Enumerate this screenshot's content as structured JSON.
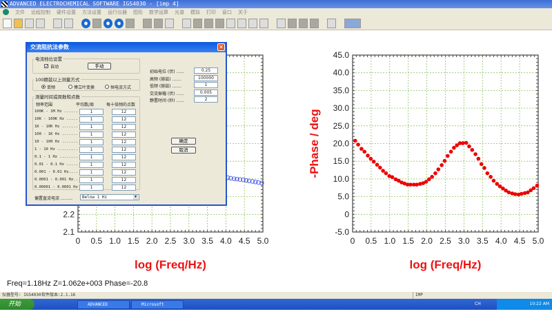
{
  "window": {
    "title": "ADVANCED ELECTROCHEMICAL SOFTWARE IGS4030 - [imp 4]"
  },
  "menu": [
    "文件",
    "远程控制",
    "硬件设置",
    "方法设置",
    "运行仪器",
    "图形",
    "数学运算",
    "光谱",
    "模拟",
    "打印",
    "窗口",
    "关于"
  ],
  "readout": "Freq=1.18Hz  Z=1.062e+003  Phase=-20.8",
  "status": {
    "model": "仪器型号: IGS4030",
    "version": "软件版本:2.1.16",
    "mode": "IMP"
  },
  "taskbar": {
    "start": "开始",
    "tasks": [
      "ADVANCED ELECTRO...",
      "Microsoft PowerP..."
    ],
    "lang": "CH",
    "clock": "10:22 AM"
  },
  "dialog": {
    "title": "交流阻抗法参数",
    "current_group": "电流档位设置",
    "auto_label": "自动",
    "auto_checked": true,
    "manual_button": "手动",
    "mode_group": "100赫兹以上测量方式",
    "modes": [
      "单频",
      "傅立叶变换",
      "恒电流方式"
    ],
    "mode_selected": 0,
    "table_group": "测量时间或周数和点数",
    "headers": [
      "频率范围",
      "平均数/周",
      "每十倍频的点数"
    ],
    "rows": [
      {
        "range": "100K - 1M Hz ......",
        "avg": "1",
        "pts": "12"
      },
      {
        "range": "10K - 100K Hz .....",
        "avg": "1",
        "pts": "12"
      },
      {
        "range": "1K - 10K Hz .......",
        "avg": "1",
        "pts": "12"
      },
      {
        "range": "100 - 1K Hz .......",
        "avg": "1",
        "pts": "12"
      },
      {
        "range": "10 - 100 Hz .......",
        "avg": "1",
        "pts": "12"
      },
      {
        "range": "1 - 10 Hz .........",
        "avg": "1",
        "pts": "12"
      },
      {
        "range": "0.1 - 1 Hz ........",
        "avg": "1",
        "pts": "12"
      },
      {
        "range": "0.01 - 0.1 Hz .....",
        "avg": "1",
        "pts": "12"
      },
      {
        "range": "0.001 - 0.01 Hz....",
        "avg": "1",
        "pts": "12"
      },
      {
        "range": "0.0001 - 0.001 Hz..",
        "avg": "1",
        "pts": "12"
      },
      {
        "range": "0.00001 - 0.0001 Hz",
        "avg": "1",
        "pts": "12"
      }
    ],
    "fields": [
      {
        "label": "初始电位 (伏) ......",
        "value": "0.25"
      },
      {
        "label": "高频 (赫兹) .......",
        "value": "100000"
      },
      {
        "label": "低频 (赫兹) .......",
        "value": "1"
      },
      {
        "label": "交流振幅 (伏) ......",
        "value": "0.005"
      },
      {
        "label": "静置时间 (秒) ......",
        "value": "2"
      }
    ],
    "ok": "确定",
    "cancel": "取消",
    "bias_label": "偏置直流电流 .........",
    "bias_value": "Below 1 Hz"
  },
  "chart_data": [
    {
      "type": "scatter",
      "title": "",
      "xlabel": "log (Freq/Hz)",
      "ylabel": "",
      "xlim": [
        0,
        5
      ],
      "ylim": [
        2.1,
        3.1
      ],
      "xticks": [
        "0",
        "0.5",
        "1.0",
        "1.5",
        "2.0",
        "2.5",
        "3.0",
        "3.5",
        "4.0",
        "4.5",
        "5.0"
      ],
      "yticks_visible": [
        "2.2",
        "2.1"
      ],
      "color": "#3344ee",
      "marker": "open-circle",
      "x": [
        4.05,
        4.13,
        4.22,
        4.3,
        4.38,
        4.47,
        4.55,
        4.63,
        4.72,
        4.8,
        4.88,
        4.97
      ],
      "y": [
        2.407,
        2.404,
        2.401,
        2.399,
        2.397,
        2.395,
        2.392,
        2.389,
        2.386,
        2.383,
        2.38,
        2.377
      ]
    },
    {
      "type": "scatter",
      "title": "",
      "xlabel": "log (Freq/Hz)",
      "ylabel": "-Phase / deg",
      "xlim": [
        0,
        5
      ],
      "ylim": [
        -5,
        45
      ],
      "xticks": [
        "0",
        "0.5",
        "1.0",
        "1.5",
        "2.0",
        "2.5",
        "3.0",
        "3.5",
        "4.0",
        "4.5",
        "5.0"
      ],
      "yticks": [
        "-5.0",
        "0",
        "5.0",
        "10.0",
        "15.0",
        "20.0",
        "25.0",
        "30.0",
        "35.0",
        "40.0",
        "45.0"
      ],
      "color": "#ee0000",
      "marker": "filled-circle",
      "x": [
        0.07,
        0.15,
        0.24,
        0.32,
        0.41,
        0.49,
        0.57,
        0.66,
        0.74,
        0.82,
        0.9,
        0.99,
        1.07,
        1.16,
        1.24,
        1.32,
        1.4,
        1.48,
        1.56,
        1.65,
        1.73,
        1.82,
        1.9,
        1.98,
        2.06,
        2.14,
        2.23,
        2.31,
        2.4,
        2.48,
        2.56,
        2.65,
        2.73,
        2.81,
        2.89,
        2.97,
        3.06,
        3.14,
        3.22,
        3.31,
        3.39,
        3.47,
        3.55,
        3.63,
        3.72,
        3.8,
        3.89,
        3.97,
        4.05,
        4.13,
        4.21,
        4.3,
        4.38,
        4.47,
        4.55,
        4.64,
        4.72,
        4.8,
        4.88,
        4.97
      ],
      "y": [
        20.8,
        19.7,
        18.5,
        17.7,
        16.6,
        15.7,
        14.9,
        14.0,
        13.2,
        12.3,
        11.6,
        10.8,
        10.5,
        9.9,
        9.5,
        9.0,
        8.7,
        8.4,
        8.4,
        8.4,
        8.4,
        8.6,
        8.8,
        9.2,
        9.9,
        10.6,
        11.6,
        12.7,
        13.9,
        15.1,
        16.5,
        17.7,
        18.8,
        19.5,
        20.1,
        20.1,
        20.2,
        19.2,
        18.2,
        17.0,
        15.7,
        14.2,
        13.1,
        11.6,
        10.6,
        9.5,
        8.6,
        7.9,
        7.3,
        6.7,
        6.2,
        5.9,
        5.7,
        5.6,
        5.8,
        6.0,
        6.2,
        6.8,
        7.4,
        8.1
      ]
    }
  ]
}
